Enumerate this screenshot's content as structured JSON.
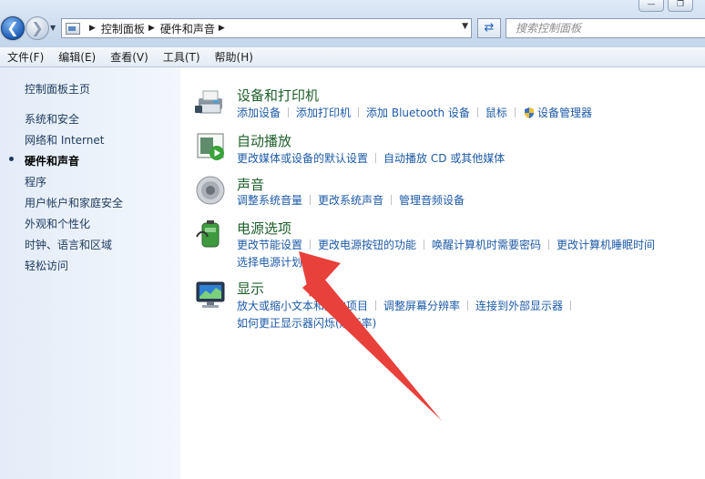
{
  "window": {
    "title_buttons": [
      "—",
      "❐"
    ]
  },
  "nav": {
    "breadcrumb": [
      "控制面板",
      "硬件和声音"
    ],
    "search_placeholder": "搜索控制面板"
  },
  "menu": [
    "文件(F)",
    "编辑(E)",
    "查看(V)",
    "工具(T)",
    "帮助(H)"
  ],
  "sidebar": {
    "items": [
      "控制面板主页",
      "系统和安全",
      "网络和 Internet",
      "硬件和声音",
      "程序",
      "用户帐户和家庭安全",
      "外观和个性化",
      "时钟、语言和区域",
      "轻松访问"
    ],
    "current_index": 3
  },
  "categories": [
    {
      "title": "设备和打印机",
      "icon": "printer-icon",
      "link_rows": [
        [
          "添加设备",
          "添加打印机",
          "添加 Bluetooth 设备",
          "鼠标",
          "设备管理器"
        ]
      ]
    },
    {
      "title": "自动播放",
      "icon": "autoplay-icon",
      "link_rows": [
        [
          "更改媒体或设备的默认设置",
          "自动播放 CD 或其他媒体"
        ]
      ]
    },
    {
      "title": "声音",
      "icon": "speaker-icon",
      "link_rows": [
        [
          "调整系统音量",
          "更改系统声音",
          "管理音频设备"
        ]
      ]
    },
    {
      "title": "电源选项",
      "icon": "battery-icon",
      "link_rows": [
        [
          "更改节能设置",
          "更改电源按钮的功能",
          "唤醒计算机时需要密码",
          "更改计算机睡眠时间"
        ],
        [
          "选择电源计划"
        ]
      ]
    },
    {
      "title": "显示",
      "icon": "monitor-icon",
      "link_rows": [
        [
          "放大或缩小文本和其他项目",
          "调整屏幕分辨率",
          "连接到外部显示器"
        ],
        [
          "如何更正显示器闪烁(刷新率)"
        ]
      ]
    }
  ],
  "colors": {
    "category_title": "#1e5f2a",
    "link": "#1c5aa8",
    "annotation_arrow": "#e8403a"
  }
}
